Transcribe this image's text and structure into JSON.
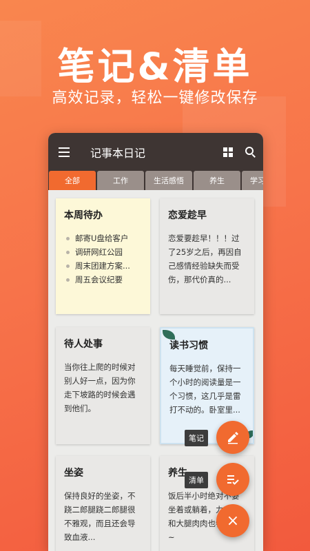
{
  "hero": {
    "title": "笔记&清单",
    "subtitle": "高效记录，轻松一键修改保存"
  },
  "app": {
    "title": "记事本日记",
    "icons": [
      "menu-icon",
      "grid-view-icon",
      "search-icon"
    ]
  },
  "tabs": [
    {
      "label": "全部",
      "active": true
    },
    {
      "label": "工作",
      "active": false
    },
    {
      "label": "生活感悟",
      "active": false
    },
    {
      "label": "养生",
      "active": false
    },
    {
      "label": "学习",
      "active": false
    }
  ],
  "notes": [
    {
      "title": "本周待办",
      "items": [
        "邮寄U盘给客户",
        "调研网红公园",
        "周末团建方案...",
        "周五会议纪要"
      ]
    },
    {
      "title": "恋爱趁早",
      "body": "恋爱要趁早！！！过了25岁之后，再因自己感情经验缺失而受伤，那代价真的..."
    },
    {
      "title": "待人处事",
      "body": "当你往上爬的时候对别人好一点，因为你走下坡路的时候会遇到他们。"
    },
    {
      "title": "读书习惯",
      "body": "每天睡觉前，保持一个小时的阅读量是一个习惯，这几乎是雷打不动的。卧室里..."
    },
    {
      "title": "坐姿",
      "body": "保持良好的坐姿，不跷二郎腿跷二郎腿很不雅观，而且还会导致血液..."
    },
    {
      "title": "养生",
      "body": "饭后半小时绝对不要坐着或躺着，力度腹和大腿肉肉也特别多~"
    }
  ],
  "fab": {
    "note_label": "笔记",
    "list_label": "清单",
    "close_symbol": "×"
  },
  "colors": {
    "accent": "#f16a2f",
    "appbar": "#3e3533",
    "tab_inactive": "#9a8f8a"
  }
}
